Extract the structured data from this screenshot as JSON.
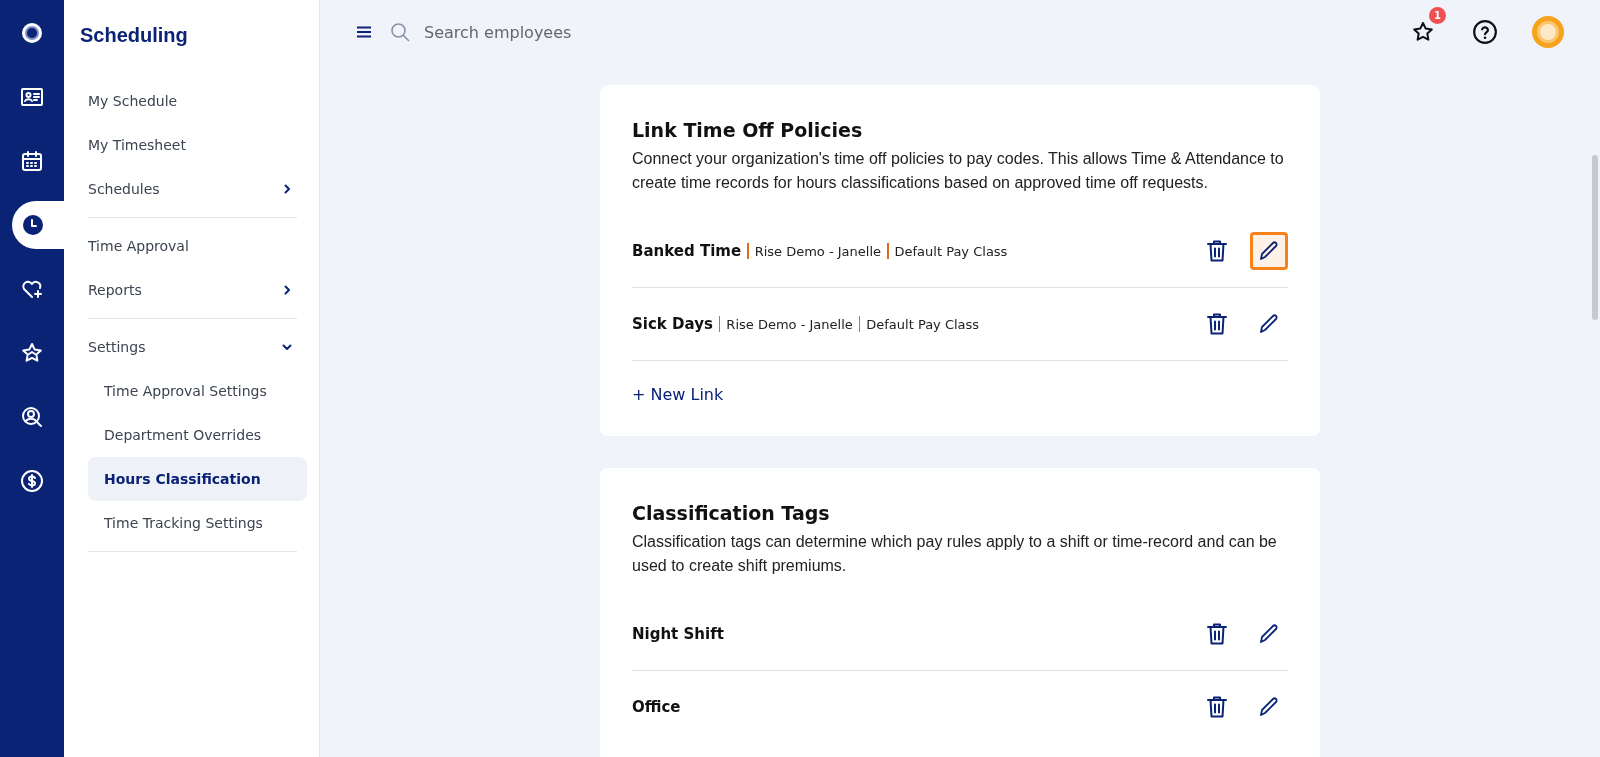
{
  "rail": [
    {
      "selected": false
    },
    {
      "selected": false
    },
    {
      "selected": false
    },
    {
      "selected": true
    },
    {
      "selected": false
    },
    {
      "selected": false
    },
    {
      "selected": false
    },
    {
      "selected": false
    }
  ],
  "sidebar": {
    "title": "Scheduling",
    "sections": [
      [
        {
          "label": "My Schedule",
          "kind": "link",
          "selected": false
        },
        {
          "label": "My Timesheet",
          "kind": "link",
          "selected": false
        },
        {
          "label": "Schedules",
          "kind": "group",
          "expanded": false,
          "selected": false
        }
      ],
      [
        {
          "label": "Time Approval",
          "kind": "link",
          "selected": false
        },
        {
          "label": "Reports",
          "kind": "group",
          "expanded": false,
          "selected": false
        }
      ],
      [
        {
          "label": "Settings",
          "kind": "group",
          "expanded": true,
          "selected": false,
          "children": [
            {
              "label": "Time Approval Settings",
              "selected": false
            },
            {
              "label": "Department Overrides",
              "selected": false
            },
            {
              "label": "Hours Classification",
              "selected": true
            },
            {
              "label": "Time Tracking Settings",
              "selected": false
            }
          ]
        }
      ]
    ]
  },
  "header": {
    "search": {
      "placeholder": "Search employees"
    },
    "notification_count": "1"
  },
  "cards": [
    {
      "title": "Link Time Off Policies",
      "description": "Connect your organization's time off policies to pay codes. This allows Time & Attendance to create time records for hours classifications based on approved time off requests.",
      "rows": [
        {
          "name": "Banked Time",
          "details": [
            "Rise Demo - Janelle",
            "Default Pay Class"
          ],
          "edit_focused": true
        },
        {
          "name": "Sick Days",
          "details": [
            "Rise Demo - Janelle",
            "Default Pay Class"
          ],
          "edit_focused": false
        }
      ],
      "add_link": "+ New Link"
    },
    {
      "title": "Classification Tags",
      "description": "Classification tags can determine which pay rules apply to a shift or time-record and can be used to create shift premiums.",
      "rows": [
        {
          "name": "Night Shift",
          "details": [],
          "edit_focused": false
        },
        {
          "name": "Office",
          "details": [],
          "edit_focused": false
        }
      ]
    }
  ]
}
